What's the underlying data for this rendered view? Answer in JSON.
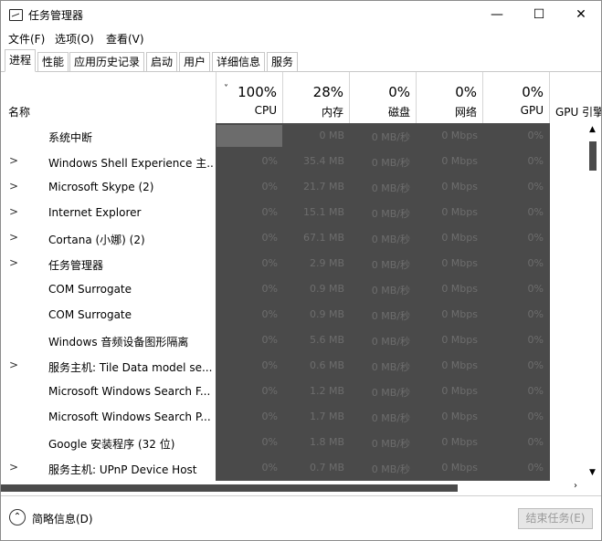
{
  "window": {
    "title": "任务管理器",
    "minimize_glyph": "—",
    "maximize_glyph": "☐",
    "close_glyph": "✕"
  },
  "menu": [
    "文件(F)",
    "选项(O)",
    "查看(V)"
  ],
  "tabs": [
    "进程",
    "性能",
    "应用历史记录",
    "启动",
    "用户",
    "详细信息",
    "服务"
  ],
  "header": {
    "name": "名称",
    "sort_glyph": "˅",
    "cpu": {
      "pct": "100%",
      "label": "CPU"
    },
    "mem": {
      "pct": "28%",
      "label": "内存"
    },
    "disk": {
      "pct": "0%",
      "label": "磁盘"
    },
    "net": {
      "pct": "0%",
      "label": "网络"
    },
    "gpu": {
      "pct": "0%",
      "label": "GPU"
    },
    "gpu_engine": {
      "label": "GPU 引擎"
    }
  },
  "processes": [
    {
      "expand": "",
      "name": "系统中断",
      "cpu": "",
      "mem": "0 MB",
      "disk": "0 MB/秒",
      "net": "0 Mbps",
      "gpu": "0%"
    },
    {
      "expand": ">",
      "name": "Windows Shell Experience 主...",
      "cpu": "0%",
      "mem": "35.4 MB",
      "disk": "0 MB/秒",
      "net": "0 Mbps",
      "gpu": "0%"
    },
    {
      "expand": ">",
      "name": "Microsoft Skype (2)",
      "cpu": "0%",
      "mem": "21.7 MB",
      "disk": "0 MB/秒",
      "net": "0 Mbps",
      "gpu": "0%"
    },
    {
      "expand": ">",
      "name": "Internet Explorer",
      "cpu": "0%",
      "mem": "15.1 MB",
      "disk": "0 MB/秒",
      "net": "0 Mbps",
      "gpu": "0%"
    },
    {
      "expand": ">",
      "name": "Cortana (小娜) (2)",
      "cpu": "0%",
      "mem": "67.1 MB",
      "disk": "0 MB/秒",
      "net": "0 Mbps",
      "gpu": "0%"
    },
    {
      "expand": ">",
      "name": "任务管理器",
      "cpu": "0%",
      "mem": "2.9 MB",
      "disk": "0 MB/秒",
      "net": "0 Mbps",
      "gpu": "0%"
    },
    {
      "expand": "",
      "name": "COM Surrogate",
      "cpu": "0%",
      "mem": "0.9 MB",
      "disk": "0 MB/秒",
      "net": "0 Mbps",
      "gpu": "0%"
    },
    {
      "expand": "",
      "name": "COM Surrogate",
      "cpu": "0%",
      "mem": "0.9 MB",
      "disk": "0 MB/秒",
      "net": "0 Mbps",
      "gpu": "0%"
    },
    {
      "expand": "",
      "name": "Windows 音频设备图形隔离",
      "cpu": "0%",
      "mem": "5.6 MB",
      "disk": "0 MB/秒",
      "net": "0 Mbps",
      "gpu": "0%"
    },
    {
      "expand": ">",
      "name": "服务主机: Tile Data model se...",
      "cpu": "0%",
      "mem": "0.6 MB",
      "disk": "0 MB/秒",
      "net": "0 Mbps",
      "gpu": "0%"
    },
    {
      "expand": "",
      "name": "Microsoft Windows Search F...",
      "cpu": "0%",
      "mem": "1.2 MB",
      "disk": "0 MB/秒",
      "net": "0 Mbps",
      "gpu": "0%"
    },
    {
      "expand": "",
      "name": "Microsoft Windows Search P...",
      "cpu": "0%",
      "mem": "1.7 MB",
      "disk": "0 MB/秒",
      "net": "0 Mbps",
      "gpu": "0%"
    },
    {
      "expand": "",
      "name": "Google 安装程序 (32 位)",
      "cpu": "0%",
      "mem": "1.8 MB",
      "disk": "0 MB/秒",
      "net": "0 Mbps",
      "gpu": "0%"
    },
    {
      "expand": ">",
      "name": "服务主机: UPnP Device Host",
      "cpu": "0%",
      "mem": "0.7 MB",
      "disk": "0 MB/秒",
      "net": "0 Mbps",
      "gpu": "0%"
    }
  ],
  "footer": {
    "less_details": "简略信息(D)",
    "less_glyph": "⌃",
    "end_task": "结束任务(E)"
  },
  "scroll_glyphs": {
    "up": "▲",
    "down": "▼",
    "right": "›"
  },
  "colors": {
    "dark_cells": "#4a4a4a",
    "cell_text": "#6d6d6d"
  }
}
